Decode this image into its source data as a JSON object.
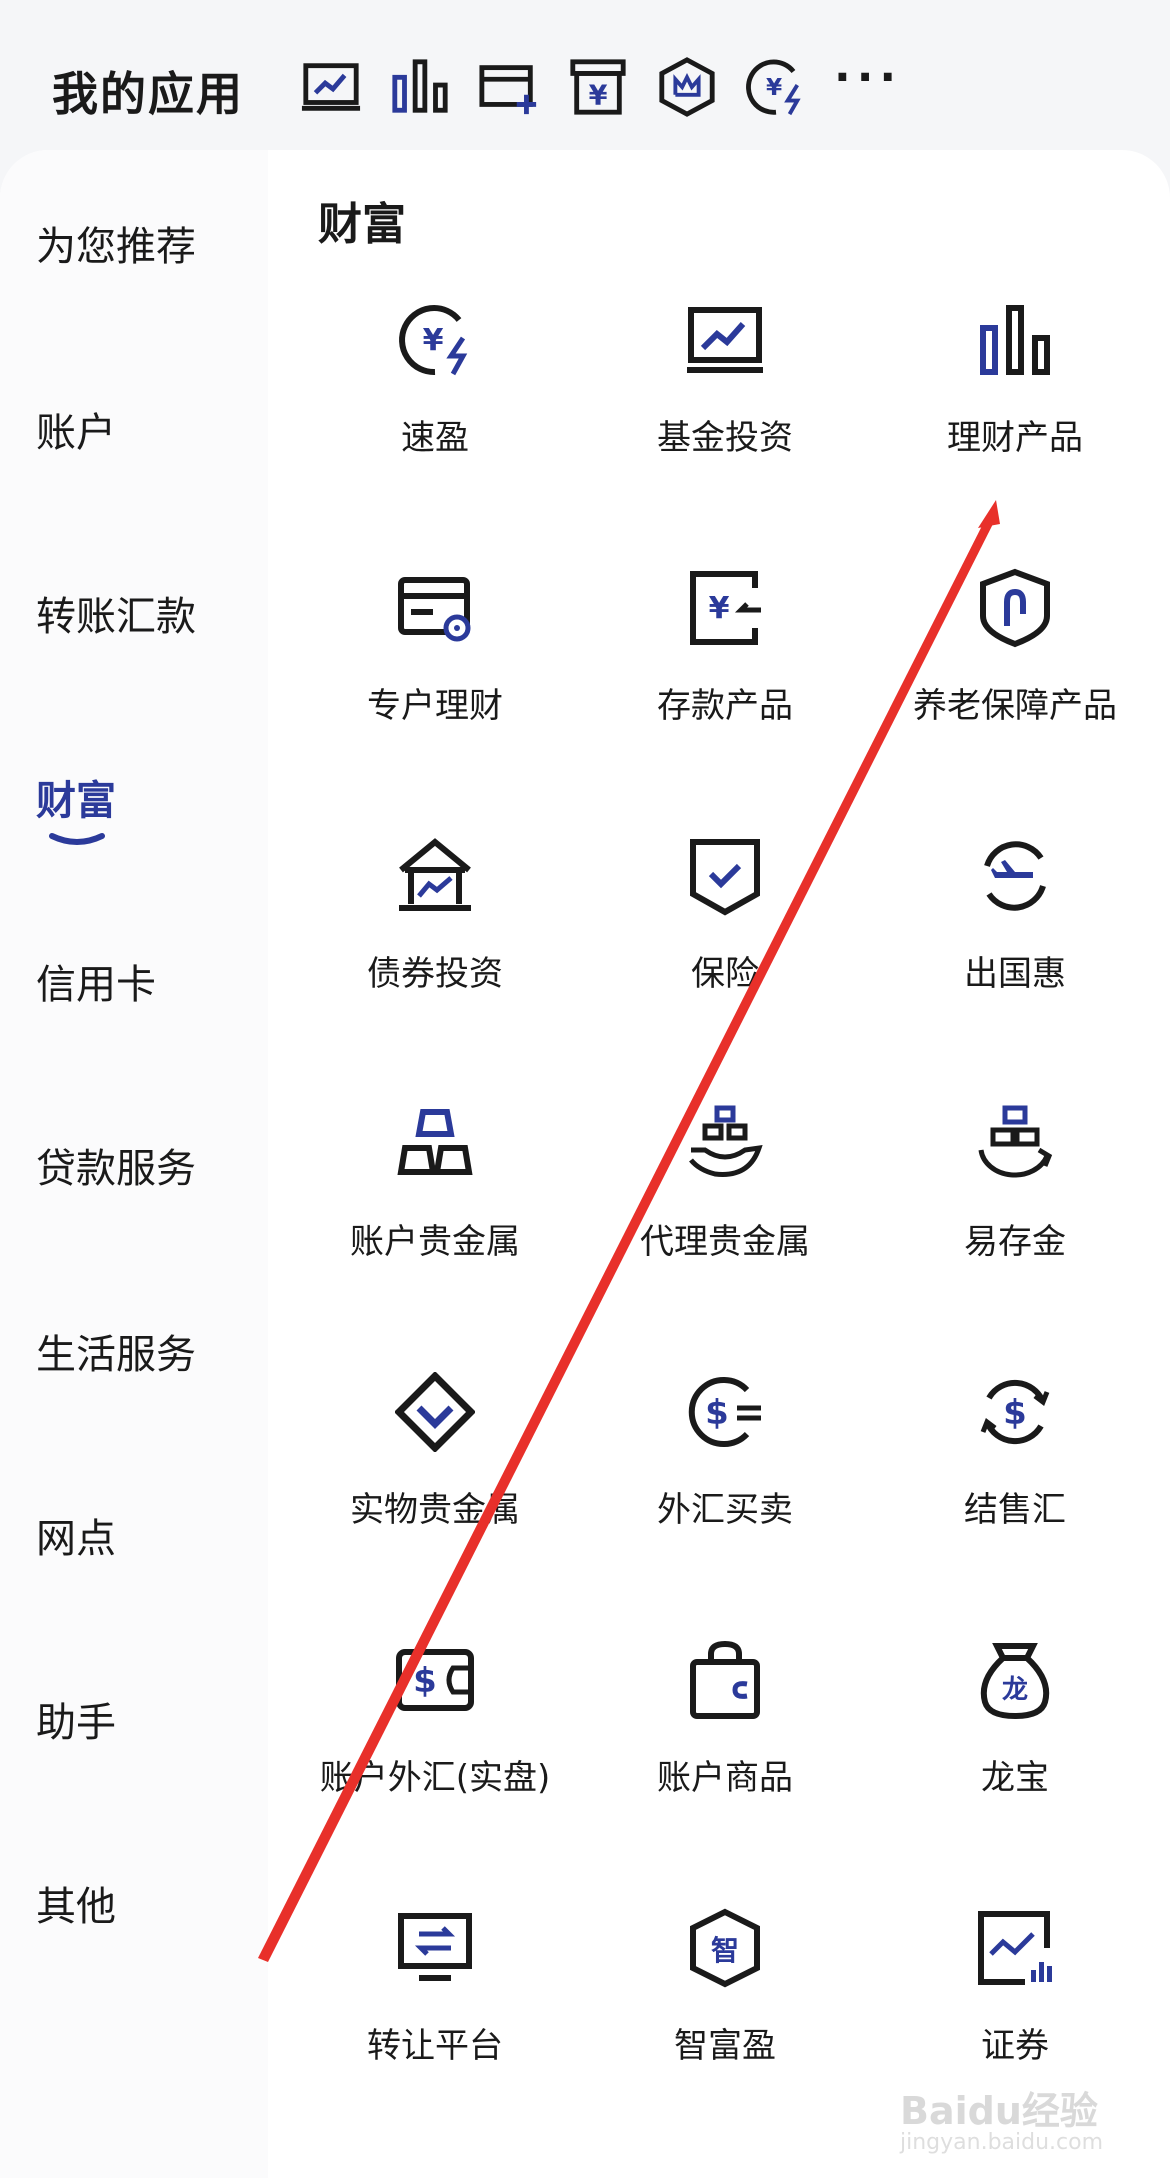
{
  "header": {
    "title": "我的应用",
    "shortcut_icons": [
      "chart-up-icon",
      "bar-chart-icon",
      "card-add-icon",
      "yuan-box-icon",
      "crown-shield-icon",
      "yuan-flash-icon"
    ],
    "more_label": "···"
  },
  "sidebar": {
    "items": [
      {
        "label": "为您推荐"
      },
      {
        "label": "账户"
      },
      {
        "label": "转账汇款"
      },
      {
        "label": "财富"
      },
      {
        "label": "信用卡"
      },
      {
        "label": "贷款服务"
      },
      {
        "label": "生活服务"
      },
      {
        "label": "网点"
      },
      {
        "label": "助手"
      },
      {
        "label": "其他"
      }
    ],
    "active": "财富"
  },
  "section": {
    "title": "财富",
    "apps": [
      {
        "label": "速盈",
        "icon": "yuan-flash-icon"
      },
      {
        "label": "基金投资",
        "icon": "chart-up-icon"
      },
      {
        "label": "理财产品",
        "icon": "bar-chart-icon"
      },
      {
        "label": "专户理财",
        "icon": "card-coin-icon"
      },
      {
        "label": "存款产品",
        "icon": "yuan-doc-icon"
      },
      {
        "label": "养老保障产品",
        "icon": "shield-icon"
      },
      {
        "label": "债券投资",
        "icon": "bond-house-icon"
      },
      {
        "label": "保险",
        "icon": "shield-check-icon"
      },
      {
        "label": "出国惠",
        "icon": "plane-cycle-icon"
      },
      {
        "label": "账户贵金属",
        "icon": "gold-bars-icon"
      },
      {
        "label": "代理贵金属",
        "icon": "hand-gold-icon"
      },
      {
        "label": "易存金",
        "icon": "gold-cycle-icon"
      },
      {
        "label": "实物贵金属",
        "icon": "diamond-icon"
      },
      {
        "label": "外汇买卖",
        "icon": "dollar-exchange-icon"
      },
      {
        "label": "结售汇",
        "icon": "dollar-cycle-icon"
      },
      {
        "label": "账户外汇(实盘)",
        "icon": "dollar-wallet-icon"
      },
      {
        "label": "账户商品",
        "icon": "bag-icon"
      },
      {
        "label": "龙宝",
        "icon": "money-bag-icon"
      },
      {
        "label": "转让平台",
        "icon": "transfer-screen-icon"
      },
      {
        "label": "智富盈",
        "icon": "hexagon-zhi-icon"
      },
      {
        "label": "证券",
        "icon": "stock-chart-icon"
      }
    ]
  },
  "watermark": {
    "text": "Baidu经验",
    "sub": "jingyan.baidu.com"
  },
  "colors": {
    "accent": "#2b3a9a",
    "icon_dark": "#1a1a1a",
    "arrow": "#e8302a"
  }
}
